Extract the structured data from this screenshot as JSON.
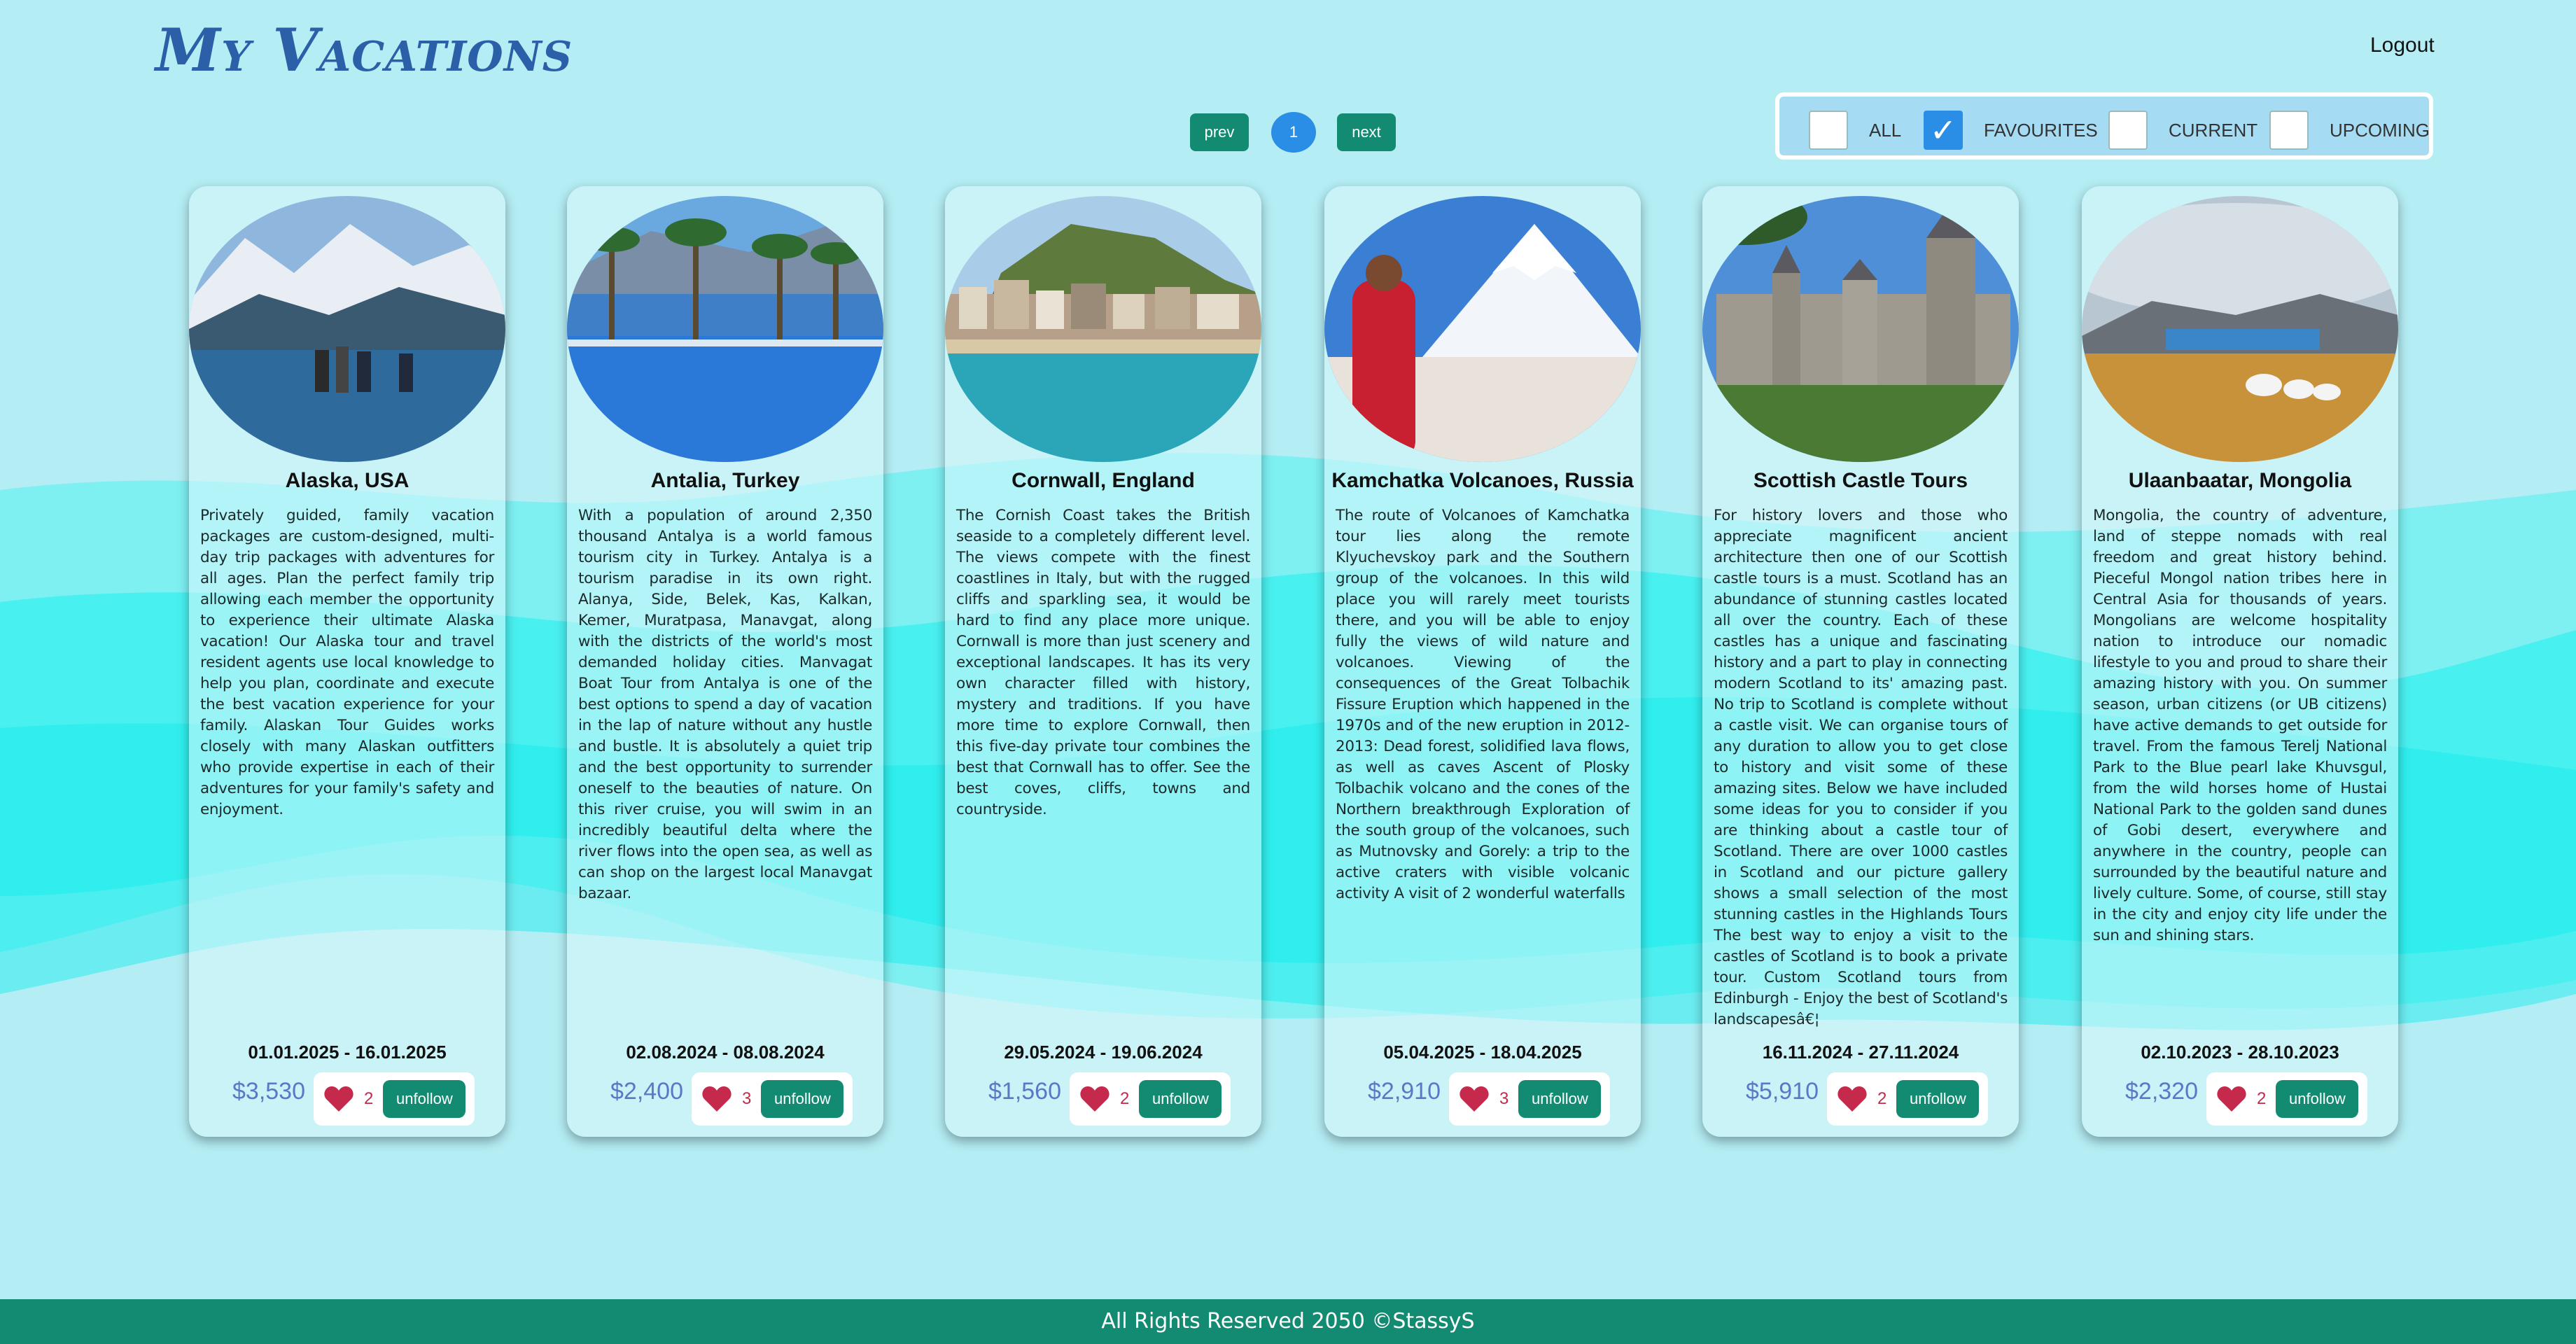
{
  "app": {
    "brand": "My Vacations",
    "logout_label": "Logout"
  },
  "pagination": {
    "prev_label": "prev",
    "current_page": "1",
    "next_label": "next"
  },
  "filters": [
    {
      "label": "ALL",
      "checked": false
    },
    {
      "label": "FAVOURITES",
      "checked": true
    },
    {
      "label": "CURRENT",
      "checked": false
    },
    {
      "label": "UPCOMING",
      "checked": false
    }
  ],
  "colors": {
    "accent_green": "#138b72",
    "accent_blue": "#2a8ee6",
    "price_blue": "#5a78c8",
    "heart_red": "#c5294c",
    "background": "#b4edf4",
    "wave": "#22f0f0"
  },
  "vacations": [
    {
      "title": "Alaska, USA",
      "description": "Privately guided, family vacation packages are custom-designed, multi-day trip packages with adventures for all ages. Plan the perfect family trip allowing each member the opportunity to experience their ultimate Alaska vacation! Our Alaska tour and travel resident agents use local knowledge to help you plan, coordinate and execute the best vacation experience for your family. Alaskan Tour Guides works closely with many Alaskan outfitters who provide expertise in each of their adventures for your family's safety and enjoyment.",
      "dates": "01.01.2025 - 16.01.2025",
      "price": "$3,530",
      "likes": "2",
      "action_label": "unfollow"
    },
    {
      "title": "Antalia, Turkey",
      "description": "With a population of around 2,350 thousand Antalya is a world famous tourism city in Turkey. Antalya is a tourism paradise in its own right. Alanya, Side, Belek, Kas, Kalkan, Kemer, Muratpasa, Manavgat, along with the districts of the world's most demanded holiday cities. Manvagat Boat Tour from Antalya is one of the best options to spend a day of vacation in the lap of nature without any hustle and bustle. It is absolutely a quiet trip and the best opportunity to surrender oneself to the beauties of nature. On this river cruise, you will swim in an incredibly beautiful delta where the river flows into the open sea, as well as can shop on the largest local Manavgat bazaar.",
      "dates": "02.08.2024 - 08.08.2024",
      "price": "$2,400",
      "likes": "3",
      "action_label": "unfollow"
    },
    {
      "title": "Cornwall, England",
      "description": "The Cornish Coast takes the British seaside to a completely different level. The views compete with the finest coastlines in Italy, but with the rugged cliffs and sparkling sea, it would be hard to find any place more unique. Cornwall is more than just scenery and exceptional landscapes. It has its very own character filled with history, mystery and traditions. If you have more time to explore Cornwall, then this five-day private tour combines the best that Cornwall has to offer. See the best coves, cliffs, towns and countryside.",
      "dates": "29.05.2024 - 19.06.2024",
      "price": "$1,560",
      "likes": "2",
      "action_label": "unfollow"
    },
    {
      "title": "Kamchatka Volcanoes, Russia",
      "description": "The route of Volcanoes of Kamchatka tour lies along the remote Klyuchevskoy park and the Southern group of the volcanoes. In this wild place you will rarely meet tourists there, and you will be able to enjoy fully the views of wild nature and volcanoes. Viewing of the consequences of the Great Tolbachik Fissure Eruption which happened in the 1970s and of the new eruption in 2012-2013: Dead forest, solidified lava flows, as well as caves Ascent of Plosky Tolbachik volcano and the cones of the Northern breakthrough Exploration of the south group of the volcanoes, such as Mutnovsky and Gorely: a trip to the active craters with visible volcanic activity A visit of 2 wonderful waterfalls",
      "dates": "05.04.2025 - 18.04.2025",
      "price": "$2,910",
      "likes": "3",
      "action_label": "unfollow"
    },
    {
      "title": "Scottish Castle Tours",
      "description": "For history lovers and those who appreciate magnificent ancient architecture then one of our Scottish castle tours is a must. Scotland has an abundance of stunning castles located all over the country. Each of these castles has a unique and fascinating history and a part to play in connecting modern Scotland to its' amazing past. No trip to Scotland is complete without a castle visit. We can organise tours of any duration to allow you to get close to history and visit some of these amazing sites. Below we have included some ideas for you to consider if you are thinking about a castle tour of Scotland. There are over 1000 castles in Scotland and our picture gallery shows a small selection of the most stunning castles in the Highlands Tours The best way to enjoy a visit to the castles of Scotland is to book a private tour. Custom Scotland tours from Edinburgh - Enjoy the best of Scotland's landscapesâ€¦",
      "dates": "16.11.2024 - 27.11.2024",
      "price": "$5,910",
      "likes": "2",
      "action_label": "unfollow"
    },
    {
      "title": "Ulaanbaatar, Mongolia",
      "description": "Mongolia, the country of adventure, land of steppe nomads with real freedom and great history behind. Pieceful Mongol nation tribes here in Central Asia for thousands of years. Mongolians are welcome hospitality nation to introduce our nomadic lifestyle to you and proud to share their amazing history with you. On summer season, urban citizens (or UB citizens) have active demands to get outside for travel. From the famous Terelj National Park to the Blue pearl lake Khuvsgul, from the wild horses home of Hustai National Park to the golden sand dunes of Gobi desert, everywhere and anywhere in the country, people can surrounded by the beautiful nature and lively culture. Some, of course, still stay in the city and enjoy city life under the sun and shining stars.",
      "dates": "02.10.2023 - 28.10.2023",
      "price": "$2,320",
      "likes": "2",
      "action_label": "unfollow"
    }
  ],
  "footer": {
    "text": "All Rights Reserved 2050 ©StassyS"
  }
}
